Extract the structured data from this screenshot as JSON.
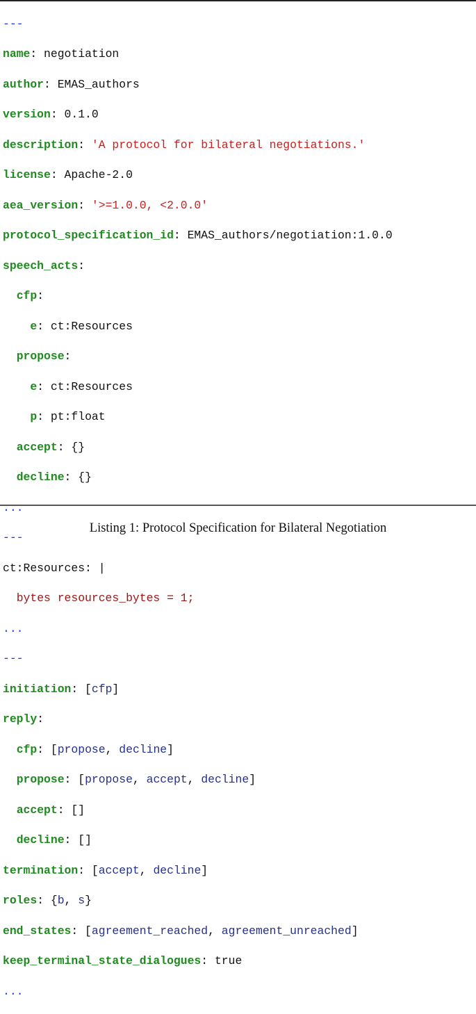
{
  "listing": {
    "doc_start": "---",
    "doc_end": "...",
    "header": {
      "name_key": "name",
      "name_val": "negotiation",
      "author_key": "author",
      "author_val": "EMAS_authors",
      "version_key": "version",
      "version_val": "0.1.0",
      "description_key": "description",
      "description_val": "'A protocol for bilateral negotiations.'",
      "license_key": "license",
      "license_val": "Apache-2.0",
      "aea_version_key": "aea_version",
      "aea_version_val": "'>=1.0.0, <2.0.0'",
      "protocol_id_key": "protocol_specification_id",
      "protocol_id_val": "EMAS_authors/negotiation:1.0.0",
      "speech_acts_key": "speech_acts",
      "cfp_key": "cfp",
      "cfp_e_key": "e",
      "cfp_e_val": "ct:Resources",
      "propose_key": "propose",
      "propose_e_key": "e",
      "propose_e_val": "ct:Resources",
      "propose_p_key": "p",
      "propose_p_val": "pt:float",
      "accept_key": "accept",
      "accept_val": "{}",
      "decline_key": "decline",
      "decline_val": "{}"
    },
    "custom_types": {
      "type_key": "ct:Resources:",
      "type_pipe": "|",
      "body": "bytes resources_bytes = 1;"
    },
    "dialogue": {
      "initiation_key": "initiation",
      "initiation_items": [
        "cfp"
      ],
      "reply_key": "reply",
      "reply_cfp_key": "cfp",
      "reply_cfp_items": [
        "propose",
        "decline"
      ],
      "reply_propose_key": "propose",
      "reply_propose_items": [
        "propose",
        "accept",
        "decline"
      ],
      "reply_accept_key": "accept",
      "reply_accept_val": "[]",
      "reply_decline_key": "decline",
      "reply_decline_val": "[]",
      "termination_key": "termination",
      "termination_items": [
        "accept",
        "decline"
      ],
      "roles_key": "roles",
      "roles_items": [
        "b",
        "s"
      ],
      "end_states_key": "end_states",
      "end_states_items": [
        "agreement_reached",
        "agreement_unreached"
      ],
      "keep_key": "keep_terminal_state_dialogues",
      "keep_val": "true"
    }
  },
  "caption": "Listing 1: Protocol Specification for Bilateral Negotiation",
  "colors": {
    "key": "#1f8a1f",
    "string": "#c8201c",
    "marker": "#1f3bdc",
    "value": "#23308f",
    "proto": "#9c1512"
  }
}
